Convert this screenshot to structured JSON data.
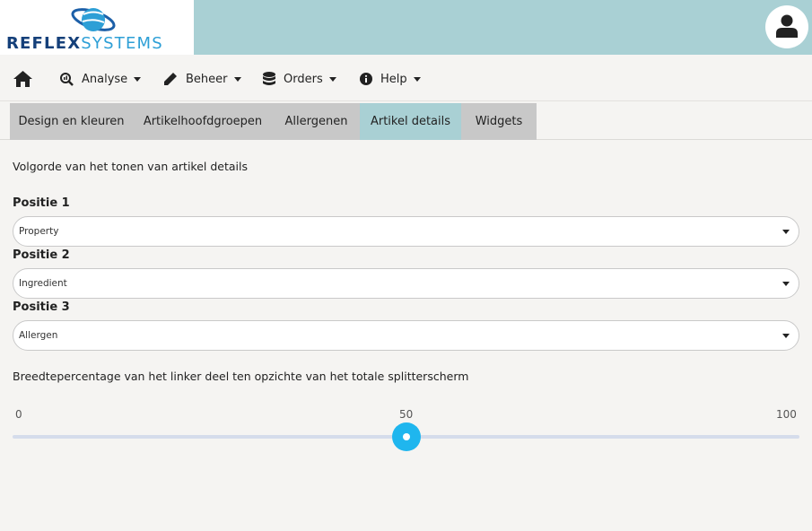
{
  "logo": {
    "part1": "REFLEX",
    "part2": "SYSTEMS"
  },
  "nav": {
    "home_icon": "home-icon",
    "items": [
      {
        "label": "Analyse",
        "icon": "search-chart-icon"
      },
      {
        "label": "Beheer",
        "icon": "pencil-icon"
      },
      {
        "label": "Orders",
        "icon": "database-icon"
      },
      {
        "label": "Help",
        "icon": "info-icon"
      }
    ]
  },
  "tabs": [
    {
      "label": "Design en kleuren",
      "active": false
    },
    {
      "label": "Artikelhoofdgroepen",
      "active": false
    },
    {
      "label": "Allergenen",
      "active": false
    },
    {
      "label": "Artikel details",
      "active": true
    },
    {
      "label": "Widgets",
      "active": false
    }
  ],
  "content": {
    "intro": "Volgorde van het tonen van artikel details",
    "positions": [
      {
        "label": "Positie 1",
        "value": "Property"
      },
      {
        "label": "Positie 2",
        "value": "Ingredient"
      },
      {
        "label": "Positie 3",
        "value": "Allergen"
      }
    ],
    "slider": {
      "description": "Breedtepercentage van het linker deel ten opzichte van het totale splitterscherm",
      "min_label": "0",
      "mid_label": "50",
      "max_label": "100",
      "value": 50
    }
  },
  "colors": {
    "header_bg": "#a9d0d4",
    "accent": "#1fb6ee",
    "tab_bg": "#c8c8c8"
  }
}
